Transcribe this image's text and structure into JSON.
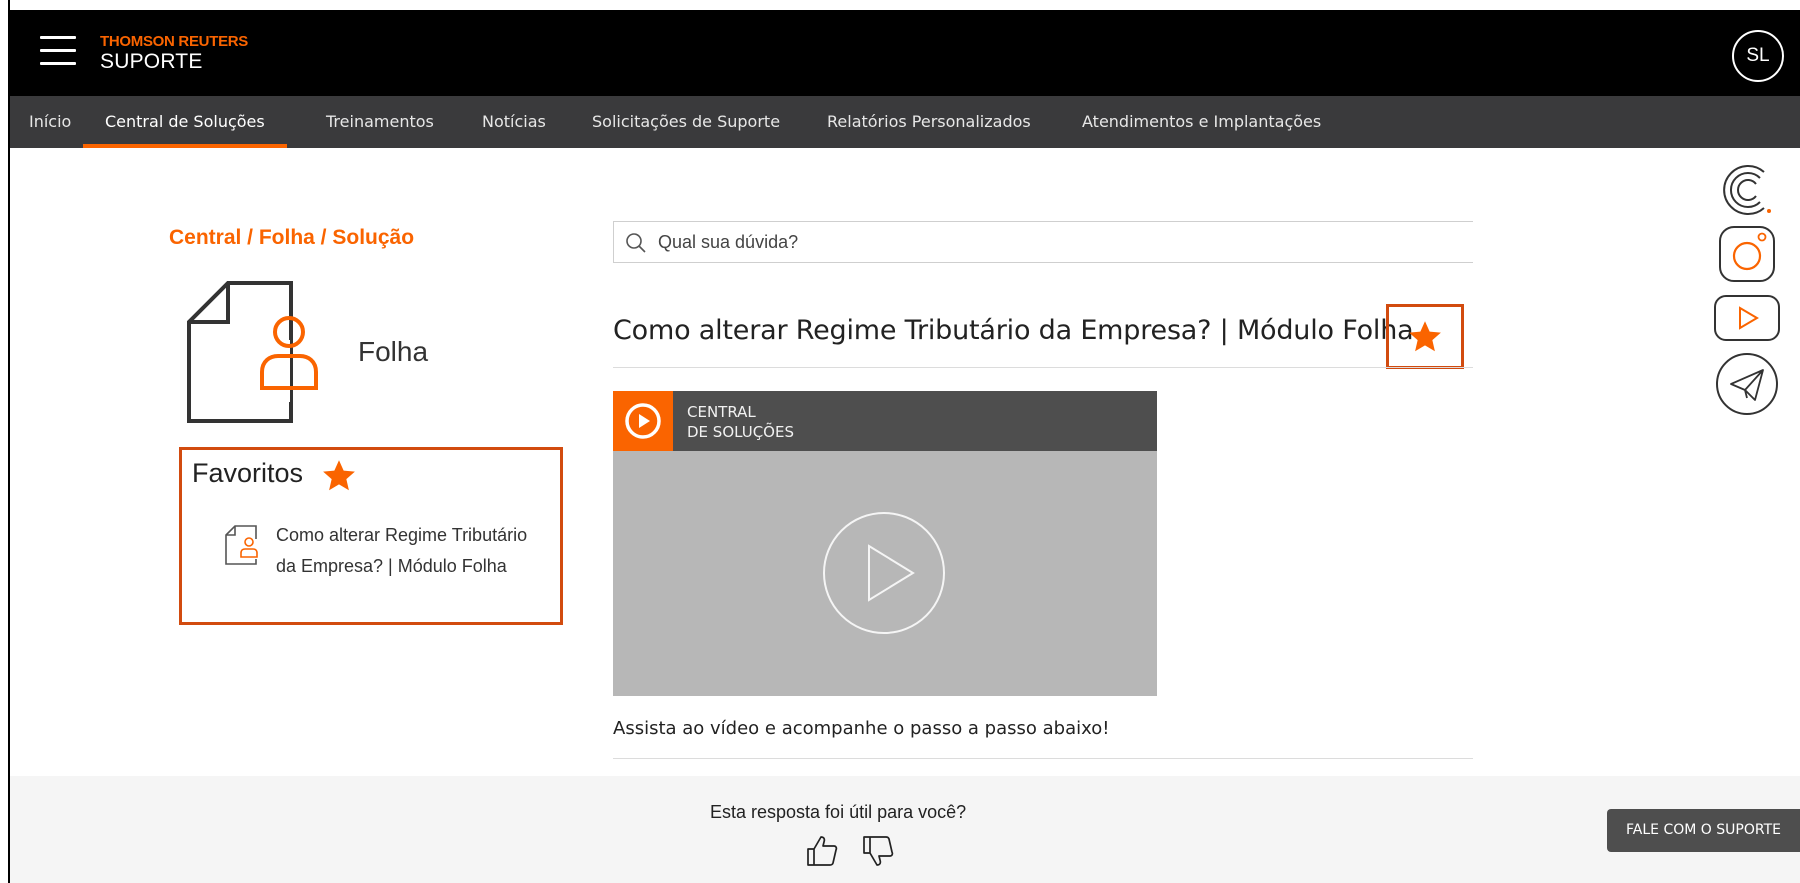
{
  "header": {
    "brand_top": "THOMSON REUTERS",
    "brand_sub": "SUPORTE",
    "user_initials": "SL"
  },
  "nav": {
    "items": [
      {
        "label": "Início",
        "active": false
      },
      {
        "label": "Central de Soluções",
        "active": true
      },
      {
        "label": "Treinamentos",
        "active": false
      },
      {
        "label": "Notícias",
        "active": false
      },
      {
        "label": "Solicitações de Suporte",
        "active": false
      },
      {
        "label": "Relatórios Personalizados",
        "active": false
      },
      {
        "label": "Atendimentos e Implantações",
        "active": false
      }
    ]
  },
  "sidebar": {
    "breadcrumb": "Central / Folha / Solução",
    "category": "Folha",
    "favorites": {
      "title": "Favoritos",
      "items": [
        {
          "label": "Como alterar Regime Tributário da Empresa? | Módulo Folha"
        }
      ]
    }
  },
  "search": {
    "placeholder": "Qual sua dúvida?"
  },
  "article": {
    "title": "Como alterar Regime Tributário da Empresa? | Módulo Folha",
    "video_caption_line1": "CENTRAL",
    "video_caption_line2": "DE SOLUÇÕES",
    "instructions": "Assista ao vídeo e acompanhe o passo a passo abaixo!"
  },
  "feedback": {
    "question": "Esta resposta foi útil para você?"
  },
  "support_button": "FALE COM O SUPORTE",
  "social": [
    "brand-c-icon",
    "instagram-icon",
    "youtube-icon",
    "telegram-icon"
  ],
  "colors": {
    "accent": "#fa6400",
    "highlight_border": "#d24b0f",
    "header_bg": "#000000",
    "nav_bg": "#3a3a3c",
    "footer_bg": "#f5f5f5",
    "support_button_bg": "#4e4e4e"
  }
}
